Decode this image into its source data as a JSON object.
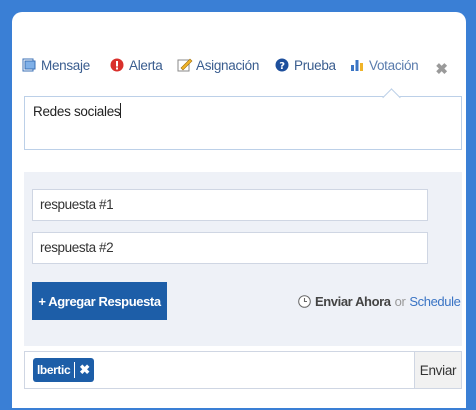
{
  "tabs": [
    {
      "label": "Mensaje",
      "icon": "message-icon"
    },
    {
      "label": "Alerta",
      "icon": "alert-icon"
    },
    {
      "label": "Asignación",
      "icon": "assignment-icon"
    },
    {
      "label": "Prueba",
      "icon": "quiz-icon"
    },
    {
      "label": "Votación",
      "icon": "poll-icon",
      "active": true
    }
  ],
  "close_label": "✖",
  "question": {
    "value": "Redes sociales"
  },
  "answers": [
    {
      "value": "respuesta #1"
    },
    {
      "value": "respuesta #2"
    }
  ],
  "add_answer_label": "+ Agregar Respuesta",
  "send_now_label": "Enviar Ahora",
  "or_label": "or",
  "schedule_label": "Schedule",
  "recipient_tag": {
    "label": "lbertic",
    "remove": "✖"
  },
  "send_label": "Enviar",
  "colors": {
    "frame_blue": "#3a7fd5",
    "primary_button": "#1d5ea8",
    "link": "#3a74c4",
    "panel_bg": "#eef1f7"
  }
}
